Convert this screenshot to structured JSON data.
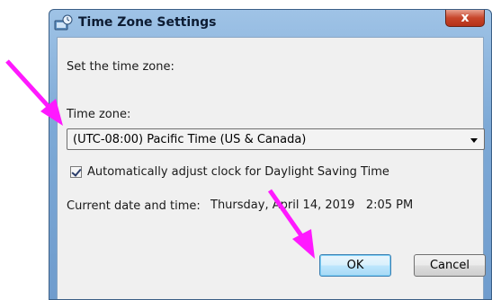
{
  "window": {
    "title": "Time Zone Settings",
    "close_label": "x"
  },
  "dialog": {
    "instruction": "Set the time zone:",
    "timezone_label": "Time zone:",
    "timezone_selected": "(UTC-08:00) Pacific Time (US & Canada)",
    "dst_checkbox_label": "Automatically adjust clock for Daylight Saving Time",
    "dst_checked": true,
    "current_label": "Current date and time:",
    "current_value": "Thursday, April 14, 2019   2:05 PM"
  },
  "buttons": {
    "ok": "OK",
    "cancel": "Cancel"
  },
  "annotations": {
    "arrow_color": "#ff19ff"
  },
  "colors": {
    "titlebar": "#7da9d6",
    "client_bg": "#f0f0f0",
    "close": "#c7452a"
  }
}
